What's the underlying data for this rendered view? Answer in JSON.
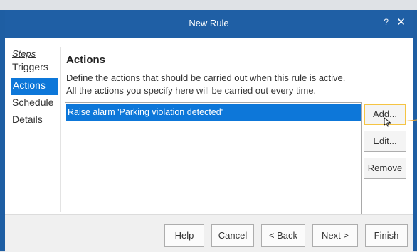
{
  "window": {
    "title": "New Rule",
    "help_glyph": "?",
    "close_glyph": "✕"
  },
  "sidebar": {
    "steps_label": "Steps",
    "items": [
      {
        "label": "Triggers",
        "active": false
      },
      {
        "label": "Actions",
        "active": true
      },
      {
        "label": "Schedule",
        "active": false
      },
      {
        "label": "Details",
        "active": false
      }
    ]
  },
  "main": {
    "heading": "Actions",
    "description_line1": "Define the actions that should be carried out when this rule is active.",
    "description_line2": "All the actions you specify here will be carried out every time.",
    "actions_list": [
      "Raise alarm 'Parking violation detected'"
    ]
  },
  "side_buttons": {
    "add": "Add...",
    "edit": "Edit...",
    "remove": "Remove"
  },
  "footer": {
    "help": "Help",
    "cancel": "Cancel",
    "back": "< Back",
    "next": "Next >",
    "finish": "Finish"
  },
  "colors": {
    "titlebar": "#1f5fa5",
    "selection": "#0d77d9",
    "focus_highlight": "#f5c443"
  }
}
